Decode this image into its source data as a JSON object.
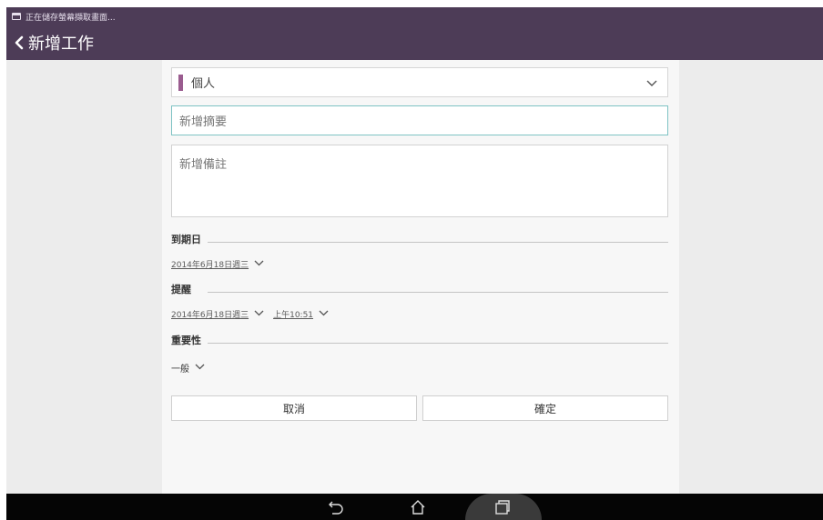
{
  "statusbar": {
    "notification_text": "正在儲存螢幕擷取畫面..."
  },
  "actionbar": {
    "title": "新增工作",
    "background": "#4d3c57"
  },
  "form": {
    "category": {
      "selected": "個人",
      "color": "#9a5c8f"
    },
    "summary": {
      "placeholder": "新增摘要"
    },
    "notes": {
      "placeholder": "新增備註"
    },
    "due_date": {
      "label": "到期日",
      "date": "2014年6月18日週三"
    },
    "reminder": {
      "label": "提醒",
      "date": "2014年6月18日週三",
      "time": "上午10:51"
    },
    "importance": {
      "label": "重要性",
      "value": "一般"
    },
    "cancel_label": "取消",
    "confirm_label": "確定"
  },
  "accent": {
    "focus_border": "#7ec3c4"
  }
}
